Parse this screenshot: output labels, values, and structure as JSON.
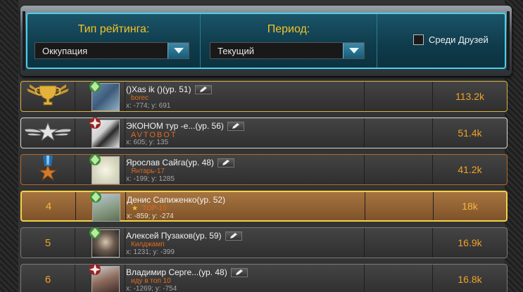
{
  "filters": {
    "rating_type_label": "Тип рейтинга:",
    "rating_type_value": "Оккупация",
    "period_label": "Период:",
    "period_value": "Текущий",
    "friends_label": "Среди Друзей",
    "friends_checked": false
  },
  "rows": [
    {
      "rank": "",
      "rank_icon": "gold-trophy-icon",
      "name": "()Xas ik ()(ур. 51)",
      "clan": "borec",
      "coords": "x: -774; y: 691",
      "score": "113.2k",
      "editable": true,
      "clan_star": false
    },
    {
      "rank": "",
      "rank_icon": "silver-wings-star-icon",
      "name": "ЭКОНОМ тур -е...(ур. 56)",
      "clan": "AVTOBOT",
      "coords": "x: 605; y: 135",
      "score": "51.4k",
      "editable": true,
      "clan_star": false
    },
    {
      "rank": "",
      "rank_icon": "bronze-medal-icon",
      "name": "Ярослав Сайга(ур. 48)",
      "clan": "Янтарь-17",
      "coords": "x: -199; y: 1285",
      "score": "41.2k",
      "editable": true,
      "clan_star": false
    },
    {
      "rank": "4",
      "rank_icon": "",
      "name": "Денис Сапиженко(ур. 52)",
      "clan": "TOP-10",
      "coords": "x: -859; y: -274",
      "score": "18k",
      "editable": false,
      "clan_star": true
    },
    {
      "rank": "5",
      "rank_icon": "",
      "name": "Алексей Пузаков(ур. 59)",
      "clan": "Килджамп",
      "coords": "x: 1231; y: -399",
      "score": "16.9k",
      "editable": true,
      "clan_star": false
    },
    {
      "rank": "6",
      "rank_icon": "",
      "name": "Владимир Серге...(ур. 48)",
      "clan": "иду в топ 10",
      "coords": "x: -1269; y: -754",
      "score": "16.8k",
      "editable": true,
      "clan_star": false
    }
  ],
  "colors": {
    "accent_gold": "#f5c227",
    "panel_border": "#49d0e8",
    "score_orange": "#f0a228",
    "clan_orange": "#e06a1f"
  }
}
